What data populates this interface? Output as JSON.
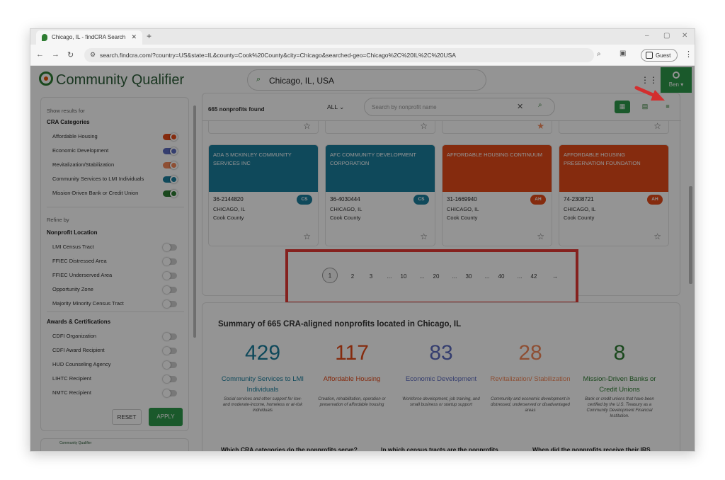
{
  "browser": {
    "tab_title": "Chicago, IL - findCRA Search",
    "url": "search.findcra.com/?country=US&state=IL&county=Cook%20County&city=Chicago&searched-geo=Chicago%2C%20IL%2C%20USA",
    "profile": "Guest"
  },
  "app": {
    "logo": "Community Qualifier",
    "search_value": "Chicago, IL, USA",
    "user": "Ben"
  },
  "sidebar": {
    "show_results_for": "Show results for",
    "cra_heading": "CRA Categories",
    "categories": [
      {
        "label": "Affordable Housing",
        "color": "#e64a19"
      },
      {
        "label": "Economic Development",
        "color": "#5c6bc0"
      },
      {
        "label": "Revitalization/Stabilization",
        "color": "#f4895b"
      },
      {
        "label": "Community Services to LMI Individuals",
        "color": "#1a7f9e"
      },
      {
        "label": "Mission-Driven Bank or Credit Union",
        "color": "#2e7d32"
      }
    ],
    "refine_by": "Refine by",
    "location_heading": "Nonprofit Location",
    "location_items": [
      "LMI Census Tract",
      "FFIEC Distressed Area",
      "FFIEC Underserved Area",
      "Opportunity Zone",
      "Majority Minority Census Tract"
    ],
    "awards_heading": "Awards & Certifications",
    "award_items": [
      "CDFI Organization",
      "CDFI Award Recipient",
      "HUD Counseling Agency",
      "LIHTC Recipient",
      "NMTC Recipient"
    ],
    "reset": "RESET",
    "apply": "APPLY"
  },
  "promo": {
    "text": "Community Qualifier"
  },
  "results": {
    "count": "665 nonprofits found",
    "filter": "ALL",
    "search_placeholder": "Search by nonprofit name",
    "cards": [
      {
        "name": "ADA S MCKINLEY COMMUNITY SERVICES INC",
        "ein": "36-2144820",
        "badge": "CS",
        "city": "CHICAGO, IL",
        "county": "Cook County",
        "color": "#1a7f9e"
      },
      {
        "name": "AFC COMMUNITY DEVELOPMENT CORPORATION",
        "ein": "36-4030444",
        "badge": "CS",
        "city": "CHICAGO, IL",
        "county": "Cook County",
        "color": "#1a7f9e"
      },
      {
        "name": "AFFORDABLE HOUSING CONTINUUM",
        "ein": "31-1669940",
        "badge": "AH",
        "city": "CHICAGO, IL",
        "county": "Cook County",
        "color": "#e64a19"
      },
      {
        "name": "AFFORDABLE HOUSING PRESERVATION FOUNDATION",
        "ein": "74-2308721",
        "badge": "AH",
        "city": "CHICAGO, IL",
        "county": "Cook County",
        "color": "#e64a19"
      }
    ]
  },
  "pagination": {
    "current": "1",
    "pages": [
      "2",
      "3",
      "...",
      "10",
      "...",
      "20",
      "...",
      "30",
      "...",
      "40",
      "...",
      "42"
    ],
    "next": "→"
  },
  "summary": {
    "title": "Summary of 665 CRA-aligned nonprofits located in Chicago, IL",
    "stats": [
      {
        "number": "429",
        "label": "Community Services to LMI Individuals",
        "desc": "Social services and other support for low- and moderate-income, homeless or at-risk individuals",
        "color": "#1a7f9e"
      },
      {
        "number": "117",
        "label": "Affordable Housing",
        "desc": "Creation, rehabilitation, operation or preservation of affordable housing",
        "color": "#e64a19"
      },
      {
        "number": "83",
        "label": "Economic Development",
        "desc": "Workforce development, job training, and small business or startup support",
        "color": "#5c6bc0"
      },
      {
        "number": "28",
        "label": "Revitalization/ Stabilization",
        "desc": "Community and economic development in distressed, underserved or disadvantaged areas",
        "color": "#f4895b"
      },
      {
        "number": "8",
        "label": "Mission-Driven Banks or Credit Unions",
        "desc": "Bank or credit unions that have been certified by the U.S. Treasury as a Community Development Financial Institution.",
        "color": "#2e7d32"
      }
    ],
    "questions": [
      "Which CRA categories do the nonprofits serve?",
      "In which census tracts are the nonprofits",
      "When did the nonprofits receive their IRS"
    ]
  }
}
